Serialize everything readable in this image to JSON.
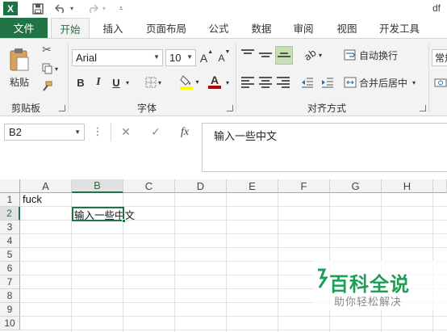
{
  "title_bar": {
    "doc_title": "df",
    "undo_icon": "undo-icon",
    "redo_icon": "redo-icon"
  },
  "tabs": {
    "file": "文件",
    "items": [
      "开始",
      "插入",
      "页面布局",
      "公式",
      "数据",
      "审阅",
      "视图",
      "开发工具"
    ],
    "active": "开始"
  },
  "ribbon": {
    "clipboard": {
      "paste": "粘贴",
      "label": "剪贴板"
    },
    "font": {
      "font_name": "Arial",
      "font_size": "10",
      "grow": "A",
      "shrink": "A",
      "bold": "B",
      "italic": "I",
      "underline": "U",
      "font_color_letter": "A",
      "label": "字体"
    },
    "alignment": {
      "wrap_text": "自动换行",
      "merge_center": "合并后居中",
      "label": "对齐方式"
    },
    "number": {
      "format": "常规"
    }
  },
  "formula_bar": {
    "name_box": "B2",
    "fx": "fx",
    "content": "输入一些中文"
  },
  "sheet": {
    "columns": [
      "A",
      "B",
      "C",
      "D",
      "E",
      "F",
      "G",
      "H"
    ],
    "rows": [
      "1",
      "2",
      "3",
      "4",
      "5",
      "6",
      "7",
      "8",
      "9",
      "10"
    ],
    "selected_cell": "B2",
    "cells": {
      "A1": "fuck",
      "B2": "输入一些中文"
    }
  },
  "watermark": {
    "title": "百科全说",
    "subtitle": "助你轻松解决"
  },
  "colors": {
    "accent": "#217346",
    "ribbon_bg": "#f3f3f3",
    "watermark": "#1e9e55"
  }
}
